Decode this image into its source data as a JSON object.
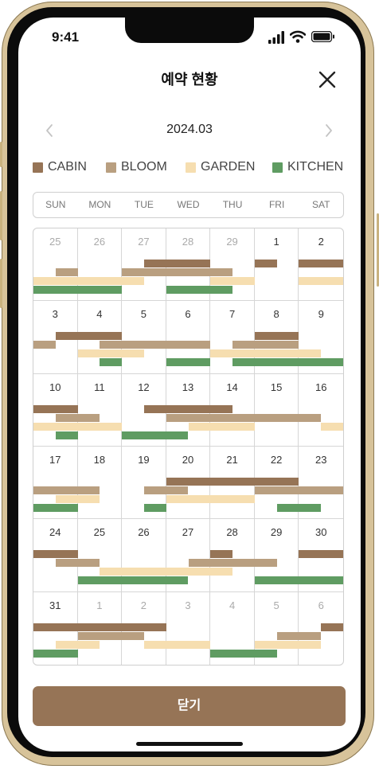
{
  "status_bar": {
    "time": "9:41"
  },
  "header": {
    "title": "예약 현황"
  },
  "month_nav": {
    "label": "2024.03"
  },
  "legend": [
    {
      "key": "cabin",
      "label": "CABIN",
      "color": "#967456"
    },
    {
      "key": "bloom",
      "label": "BLOOM",
      "color": "#b99f80"
    },
    {
      "key": "garden",
      "label": "GARDEN",
      "color": "#f6deb0"
    },
    {
      "key": "kitchen",
      "label": "KITCHEN",
      "color": "#5f9c62"
    }
  ],
  "weekdays": [
    "SUN",
    "MON",
    "TUE",
    "WED",
    "THU",
    "FRI",
    "SAT"
  ],
  "weeks": [
    {
      "days": [
        {
          "n": "25",
          "muted": true
        },
        {
          "n": "26",
          "muted": true
        },
        {
          "n": "27",
          "muted": true
        },
        {
          "n": "28",
          "muted": true
        },
        {
          "n": "29",
          "muted": true
        },
        {
          "n": "1",
          "muted": false
        },
        {
          "n": "2",
          "muted": false
        }
      ],
      "bars": [
        {
          "type": "cabin",
          "start": 2.5,
          "end": 4.0
        },
        {
          "type": "cabin",
          "start": 5.0,
          "end": 5.5
        },
        {
          "type": "cabin",
          "start": 6.0,
          "end": 7.0
        },
        {
          "type": "bloom",
          "start": 0.5,
          "end": 1.0
        },
        {
          "type": "bloom",
          "start": 2.0,
          "end": 4.5
        },
        {
          "type": "garden",
          "start": 0.0,
          "end": 2.5
        },
        {
          "type": "garden",
          "start": 4.0,
          "end": 5.0
        },
        {
          "type": "garden",
          "start": 6.0,
          "end": 7.0
        },
        {
          "type": "kitchen",
          "start": 0.0,
          "end": 2.0
        },
        {
          "type": "kitchen",
          "start": 3.0,
          "end": 4.5
        }
      ]
    },
    {
      "days": [
        {
          "n": "3",
          "muted": false
        },
        {
          "n": "4",
          "muted": false
        },
        {
          "n": "5",
          "muted": false
        },
        {
          "n": "6",
          "muted": false
        },
        {
          "n": "7",
          "muted": false
        },
        {
          "n": "8",
          "muted": false
        },
        {
          "n": "9",
          "muted": false
        }
      ],
      "bars": [
        {
          "type": "cabin",
          "start": 0.5,
          "end": 2.0
        },
        {
          "type": "cabin",
          "start": 5.0,
          "end": 6.0
        },
        {
          "type": "bloom",
          "start": 0.0,
          "end": 0.5
        },
        {
          "type": "bloom",
          "start": 1.5,
          "end": 4.0
        },
        {
          "type": "bloom",
          "start": 4.5,
          "end": 6.0
        },
        {
          "type": "garden",
          "start": 1.0,
          "end": 2.5
        },
        {
          "type": "garden",
          "start": 4.0,
          "end": 6.5
        },
        {
          "type": "kitchen",
          "start": 1.5,
          "end": 2.0
        },
        {
          "type": "kitchen",
          "start": 3.0,
          "end": 4.0
        },
        {
          "type": "kitchen",
          "start": 4.5,
          "end": 7.0
        }
      ]
    },
    {
      "days": [
        {
          "n": "10",
          "muted": false
        },
        {
          "n": "11",
          "muted": false
        },
        {
          "n": "12",
          "muted": false
        },
        {
          "n": "13",
          "muted": false
        },
        {
          "n": "14",
          "muted": false
        },
        {
          "n": "15",
          "muted": false
        },
        {
          "n": "16",
          "muted": false
        }
      ],
      "bars": [
        {
          "type": "cabin",
          "start": 0.0,
          "end": 1.0
        },
        {
          "type": "cabin",
          "start": 2.5,
          "end": 4.5
        },
        {
          "type": "bloom",
          "start": 0.5,
          "end": 1.5
        },
        {
          "type": "bloom",
          "start": 3.0,
          "end": 6.5
        },
        {
          "type": "garden",
          "start": 0.0,
          "end": 2.0
        },
        {
          "type": "garden",
          "start": 3.5,
          "end": 5.0
        },
        {
          "type": "garden",
          "start": 6.5,
          "end": 7.0
        },
        {
          "type": "kitchen",
          "start": 0.5,
          "end": 1.0
        },
        {
          "type": "kitchen",
          "start": 2.0,
          "end": 3.5
        }
      ]
    },
    {
      "days": [
        {
          "n": "17",
          "muted": false
        },
        {
          "n": "18",
          "muted": false
        },
        {
          "n": "19",
          "muted": false
        },
        {
          "n": "20",
          "muted": false
        },
        {
          "n": "21",
          "muted": false
        },
        {
          "n": "22",
          "muted": false
        },
        {
          "n": "23",
          "muted": false
        }
      ],
      "bars": [
        {
          "type": "cabin",
          "start": 3.0,
          "end": 6.0
        },
        {
          "type": "bloom",
          "start": 0.0,
          "end": 1.5
        },
        {
          "type": "bloom",
          "start": 2.5,
          "end": 3.5
        },
        {
          "type": "bloom",
          "start": 5.0,
          "end": 7.0
        },
        {
          "type": "garden",
          "start": 0.5,
          "end": 1.5
        },
        {
          "type": "garden",
          "start": 3.0,
          "end": 5.0
        },
        {
          "type": "kitchen",
          "start": 0.0,
          "end": 1.0
        },
        {
          "type": "kitchen",
          "start": 2.5,
          "end": 3.0
        },
        {
          "type": "kitchen",
          "start": 5.5,
          "end": 6.5
        }
      ]
    },
    {
      "days": [
        {
          "n": "24",
          "muted": false
        },
        {
          "n": "25",
          "muted": false
        },
        {
          "n": "26",
          "muted": false
        },
        {
          "n": "27",
          "muted": false
        },
        {
          "n": "28",
          "muted": false
        },
        {
          "n": "29",
          "muted": false
        },
        {
          "n": "30",
          "muted": false
        }
      ],
      "bars": [
        {
          "type": "cabin",
          "start": 0.0,
          "end": 1.0
        },
        {
          "type": "cabin",
          "start": 4.0,
          "end": 4.5
        },
        {
          "type": "cabin",
          "start": 6.0,
          "end": 7.0
        },
        {
          "type": "bloom",
          "start": 0.5,
          "end": 1.5
        },
        {
          "type": "bloom",
          "start": 3.5,
          "end": 5.5
        },
        {
          "type": "garden",
          "start": 1.5,
          "end": 4.5
        },
        {
          "type": "kitchen",
          "start": 1.0,
          "end": 3.5
        },
        {
          "type": "kitchen",
          "start": 5.0,
          "end": 7.0
        }
      ]
    },
    {
      "days": [
        {
          "n": "31",
          "muted": false
        },
        {
          "n": "1",
          "muted": true
        },
        {
          "n": "2",
          "muted": true
        },
        {
          "n": "3",
          "muted": true
        },
        {
          "n": "4",
          "muted": true
        },
        {
          "n": "5",
          "muted": true
        },
        {
          "n": "6",
          "muted": true
        }
      ],
      "bars": [
        {
          "type": "cabin",
          "start": 0.0,
          "end": 3.0
        },
        {
          "type": "cabin",
          "start": 6.5,
          "end": 7.0
        },
        {
          "type": "bloom",
          "start": 1.0,
          "end": 2.5
        },
        {
          "type": "bloom",
          "start": 5.5,
          "end": 6.5
        },
        {
          "type": "garden",
          "start": 0.5,
          "end": 1.5
        },
        {
          "type": "garden",
          "start": 2.5,
          "end": 4.0
        },
        {
          "type": "garden",
          "start": 5.0,
          "end": 6.5
        },
        {
          "type": "kitchen",
          "start": 0.0,
          "end": 1.0
        },
        {
          "type": "kitchen",
          "start": 4.0,
          "end": 5.5
        }
      ]
    }
  ],
  "footer": {
    "close_label": "닫기"
  }
}
